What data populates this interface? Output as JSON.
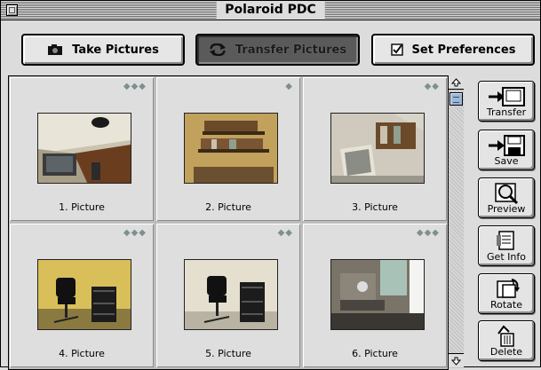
{
  "window": {
    "title": "Polaroid PDC"
  },
  "toolbar": {
    "take_pictures": "Take Pictures",
    "transfer_pictures": "Transfer Pictures",
    "set_preferences": "Set Preferences",
    "active": "transfer_pictures"
  },
  "pictures": [
    {
      "caption": "1. Picture",
      "marks": "◆◆◆"
    },
    {
      "caption": "2. Picture",
      "marks": "◆"
    },
    {
      "caption": "3. Picture",
      "marks": "◆◆"
    },
    {
      "caption": "4. Picture",
      "marks": "◆◆◆"
    },
    {
      "caption": "5. Picture",
      "marks": "◆◆"
    },
    {
      "caption": "6. Picture",
      "marks": "◆◆◆"
    }
  ],
  "side_actions": {
    "transfer": "Transfer",
    "save": "Save",
    "preview": "Preview",
    "get_info": "Get Info",
    "rotate": "Rotate",
    "delete": "Delete"
  },
  "colors": {
    "active_button": "#5a5a5a",
    "diamond": "#7f8f8f",
    "scroll_knob": "#9db7d6"
  }
}
